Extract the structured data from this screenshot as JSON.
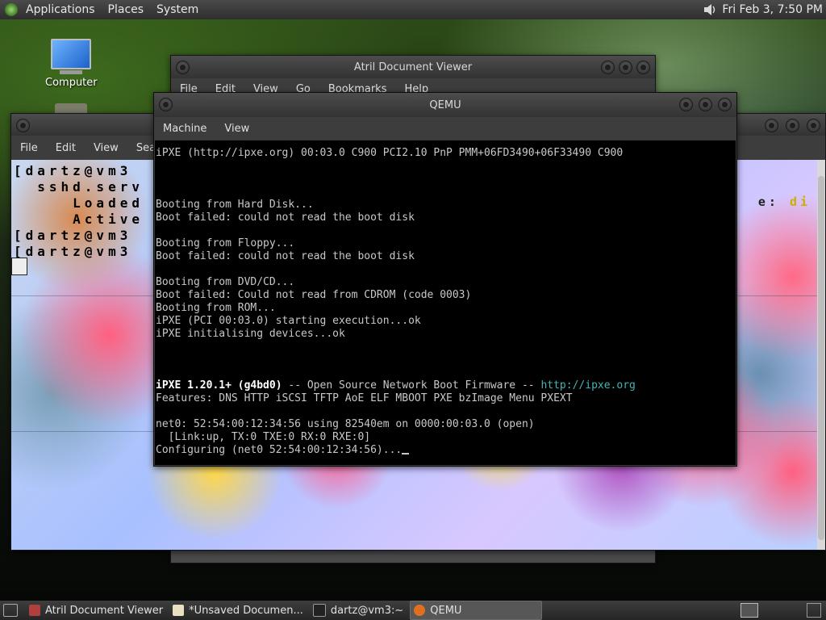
{
  "top_panel": {
    "menus": [
      "Applications",
      "Places",
      "System"
    ],
    "clock": "Fri Feb  3, 7:50 PM",
    "icons": {
      "volume": "speaker-icon"
    }
  },
  "desktop": {
    "icons": [
      {
        "label": "Computer",
        "icon": "computer-icon"
      }
    ]
  },
  "atril": {
    "title": "Atril Document Viewer",
    "menu": [
      "File",
      "Edit",
      "View",
      "Go",
      "Bookmarks",
      "Help"
    ]
  },
  "terminal": {
    "menu": [
      "File",
      "Edit",
      "View",
      "Searc"
    ],
    "lines": [
      "[dartz@vm3",
      "  sshd.serv",
      "     Loaded",
      "     Active",
      "[dartz@vm3",
      "[dartz@vm3"
    ],
    "right_text": "e:",
    "right_yellow": "di"
  },
  "qemu": {
    "title": "QEMU",
    "menu": [
      "Machine",
      "View"
    ],
    "screen": {
      "l01": "iPXE (http://ipxe.org) 00:03.0 C900 PCI2.10 PnP PMM+06FD3490+06F33490 C900",
      "l05": "Booting from Hard Disk...",
      "l06": "Boot failed: could not read the boot disk",
      "l08": "Booting from Floppy...",
      "l09": "Boot failed: could not read the boot disk",
      "l11": "Booting from DVD/CD...",
      "l12": "Boot failed: Could not read from CDROM (code 0003)",
      "l13": "Booting from ROM...",
      "l14": "iPXE (PCI 00:03.0) starting execution...ok",
      "l15": "iPXE initialising devices...ok",
      "l19a": "iPXE 1.20.1+ (g4bd0)",
      "l19b": " -- Open Source Network Boot Firmware -- ",
      "l19c": "http://ipxe.org",
      "l20": "Features: DNS HTTP iSCSI TFTP AoE ELF MBOOT PXE bzImage Menu PXEXT",
      "l22": "net0: 52:54:00:12:34:56 using 82540em on 0000:00:03.0 (open)",
      "l23": "  [Link:up, TX:0 TXE:0 RX:0 RXE:0]",
      "l24": "Configuring (net0 52:54:00:12:34:56)..."
    }
  },
  "taskbar": {
    "tasks": [
      {
        "label": "Atril Document Viewer",
        "active": false
      },
      {
        "label": "*Unsaved Documen...",
        "active": false
      },
      {
        "label": "dartz@vm3:~",
        "active": false
      },
      {
        "label": "QEMU",
        "active": true
      }
    ]
  },
  "colors": {
    "vm_text": "#c8c8c8",
    "vm_link": "#46b4b4",
    "vm_bg": "#000000"
  }
}
